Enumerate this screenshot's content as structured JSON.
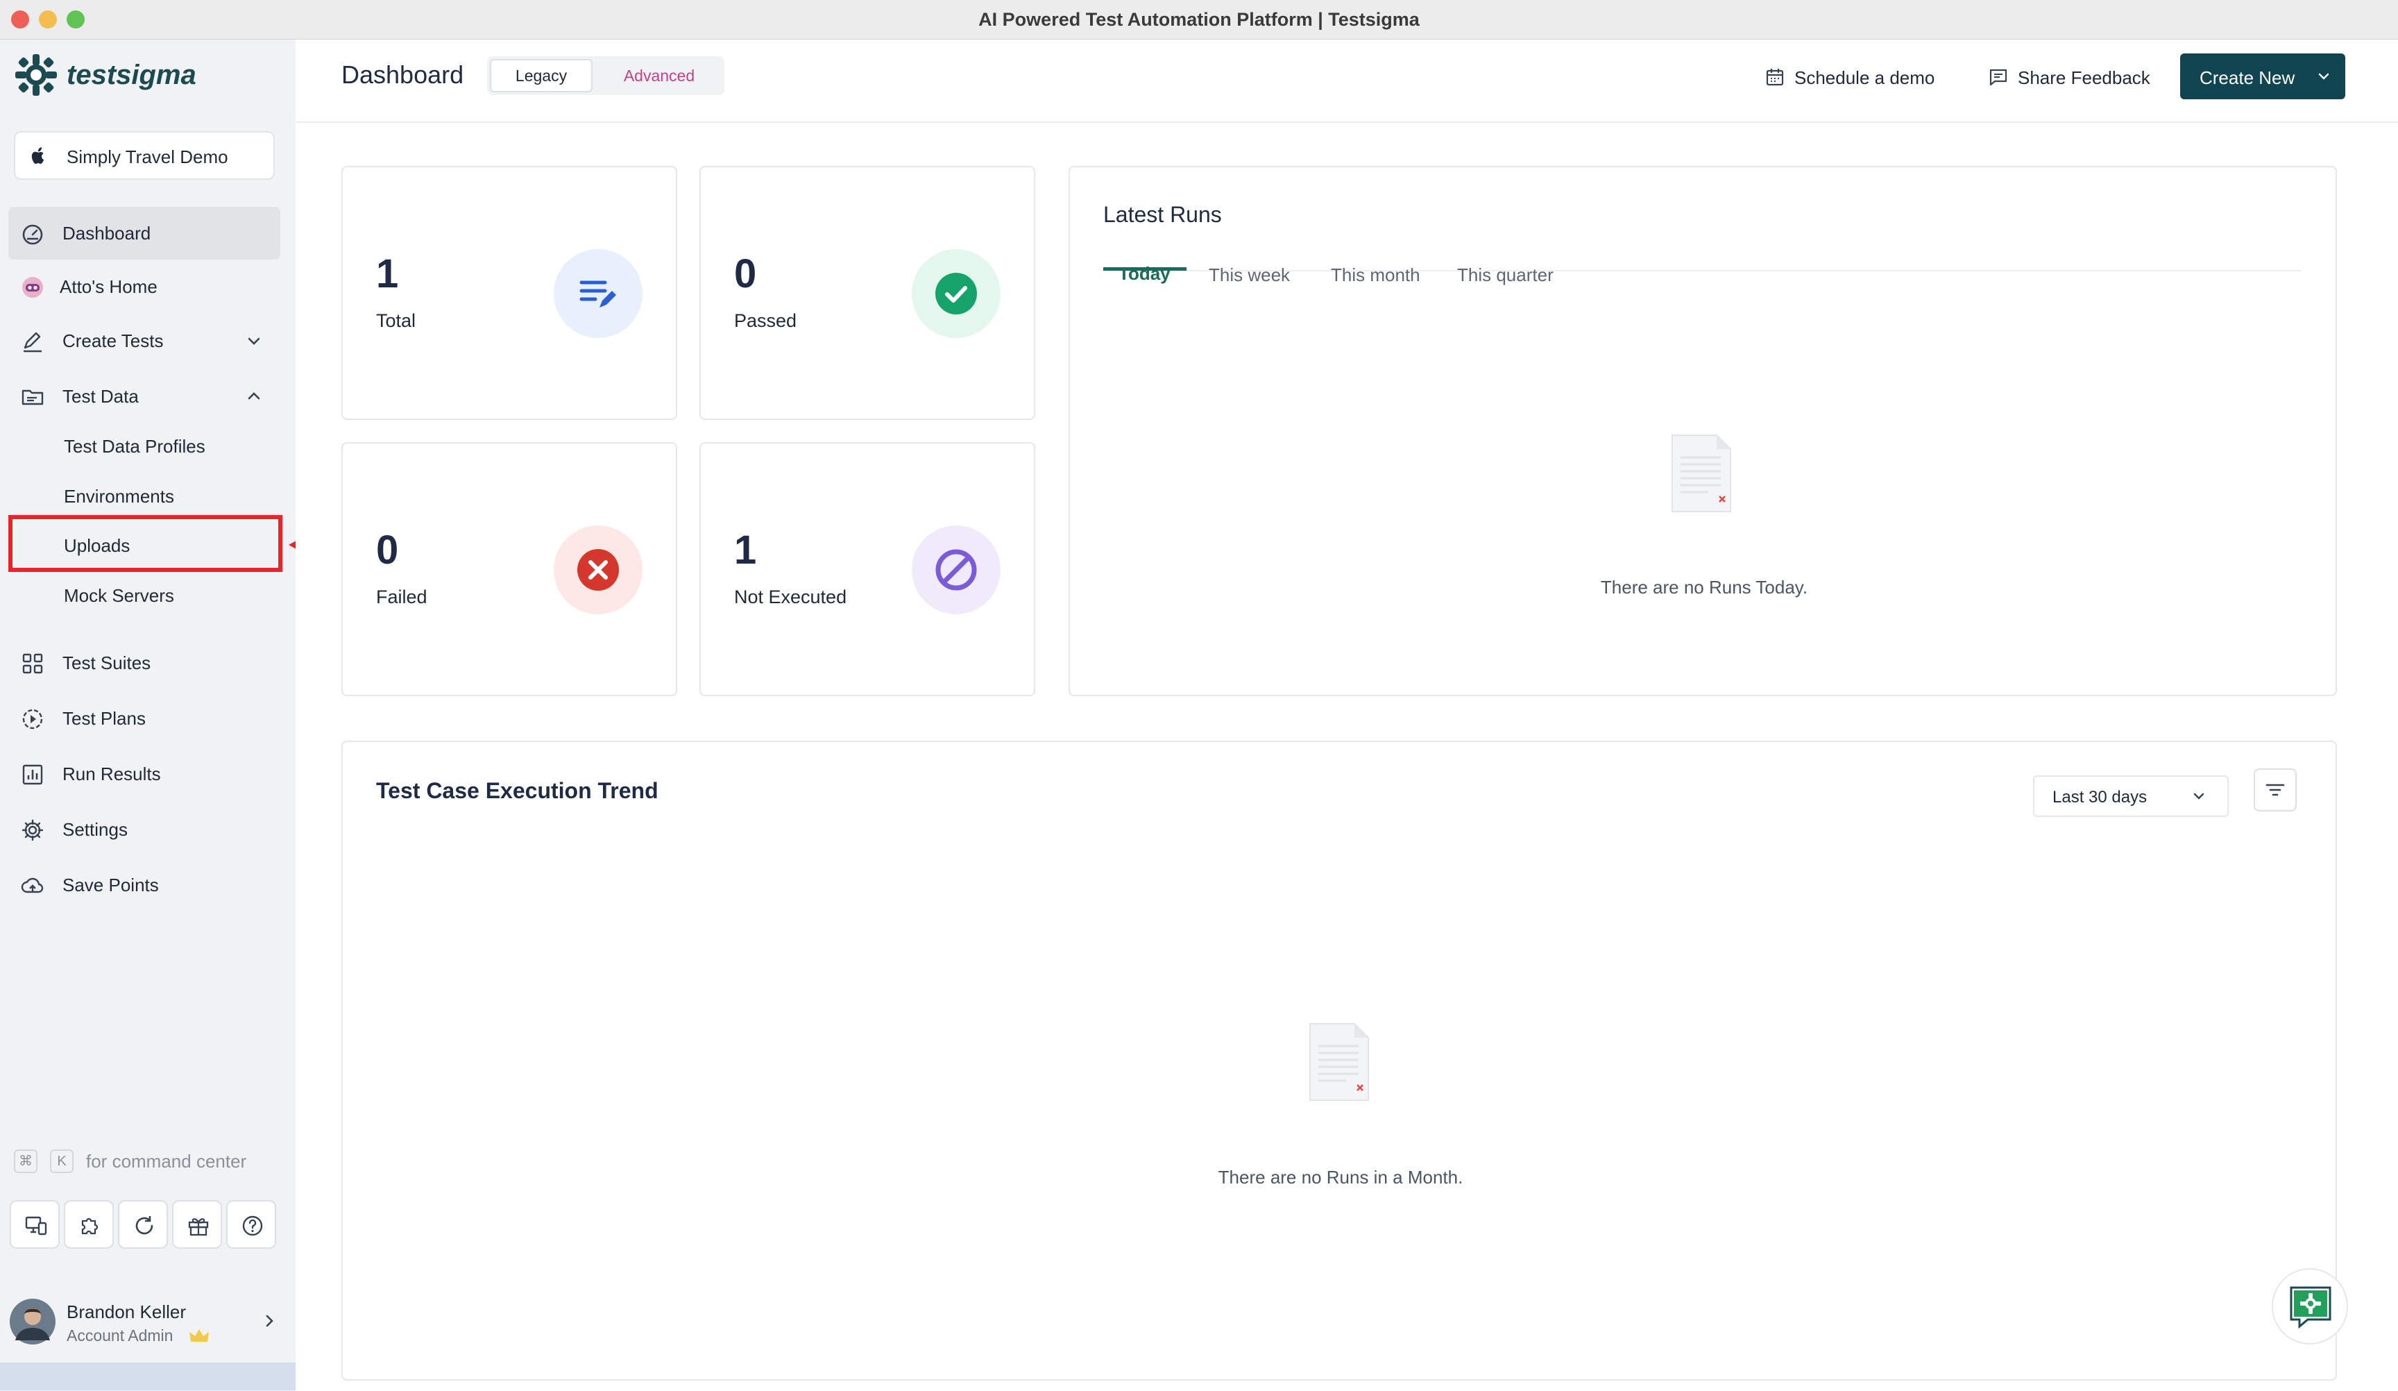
{
  "window": {
    "title": "AI Powered Test Automation Platform | Testsigma"
  },
  "brand": {
    "name": "testsigma",
    "color": "#1b4a52"
  },
  "workspace": {
    "name": "Simply Travel Demo"
  },
  "sidebar": {
    "items": [
      {
        "label": "Dashboard",
        "icon": "gauge-icon"
      },
      {
        "label": "Atto's Home",
        "icon": "atto-robot-icon"
      },
      {
        "label": "Create Tests",
        "icon": "pencil-icon"
      },
      {
        "label": "Test Data",
        "icon": "folder-icon"
      },
      {
        "label": "Test Suites",
        "icon": "grid-icon"
      },
      {
        "label": "Test Plans",
        "icon": "play-circle-icon"
      },
      {
        "label": "Run Results",
        "icon": "bar-chart-icon"
      },
      {
        "label": "Settings",
        "icon": "gear-icon"
      },
      {
        "label": "Save Points",
        "icon": "cloud-upload-icon"
      }
    ],
    "test_data_sub": [
      "Test Data Profiles",
      "Environments",
      "Uploads",
      "Mock Servers"
    ],
    "shortcut": {
      "key1": "⌘",
      "key2": "K",
      "text": "for command center"
    }
  },
  "user": {
    "name": "Brandon Keller",
    "role": "Account Admin"
  },
  "header": {
    "title": "Dashboard",
    "toggle": [
      "Legacy",
      "Advanced"
    ],
    "schedule_demo": "Schedule a demo",
    "share_feedback": "Share Feedback",
    "create_new": "Create New"
  },
  "stats": [
    {
      "value": "1",
      "label": "Total",
      "icon": "list-edit-icon",
      "bg": "#e8f0fd",
      "fg": "#2c5fd4"
    },
    {
      "value": "0",
      "label": "Passed",
      "icon": "check-circle-icon",
      "bg": "#e3f7ee",
      "fg": "#16a36a"
    },
    {
      "value": "0",
      "label": "Failed",
      "icon": "x-circle-icon",
      "bg": "#fde8e6",
      "fg": "#d4372c"
    },
    {
      "value": "1",
      "label": "Not Executed",
      "icon": "no-entry-icon",
      "bg": "#efebfb",
      "fg": "#7b5cd6"
    }
  ],
  "latest_runs": {
    "title": "Latest Runs",
    "tabs": [
      "Today",
      "This week",
      "This month",
      "This quarter"
    ],
    "empty": "There are no Runs Today."
  },
  "trend": {
    "title": "Test Case Execution Trend",
    "range": "Last 30 days",
    "empty": "There are no Runs in a Month."
  },
  "colors": {
    "accent": "#0f4450",
    "highlight_box": "#e5262a",
    "advanced": "#c2418a",
    "tab_active": "#1a6b5a"
  }
}
